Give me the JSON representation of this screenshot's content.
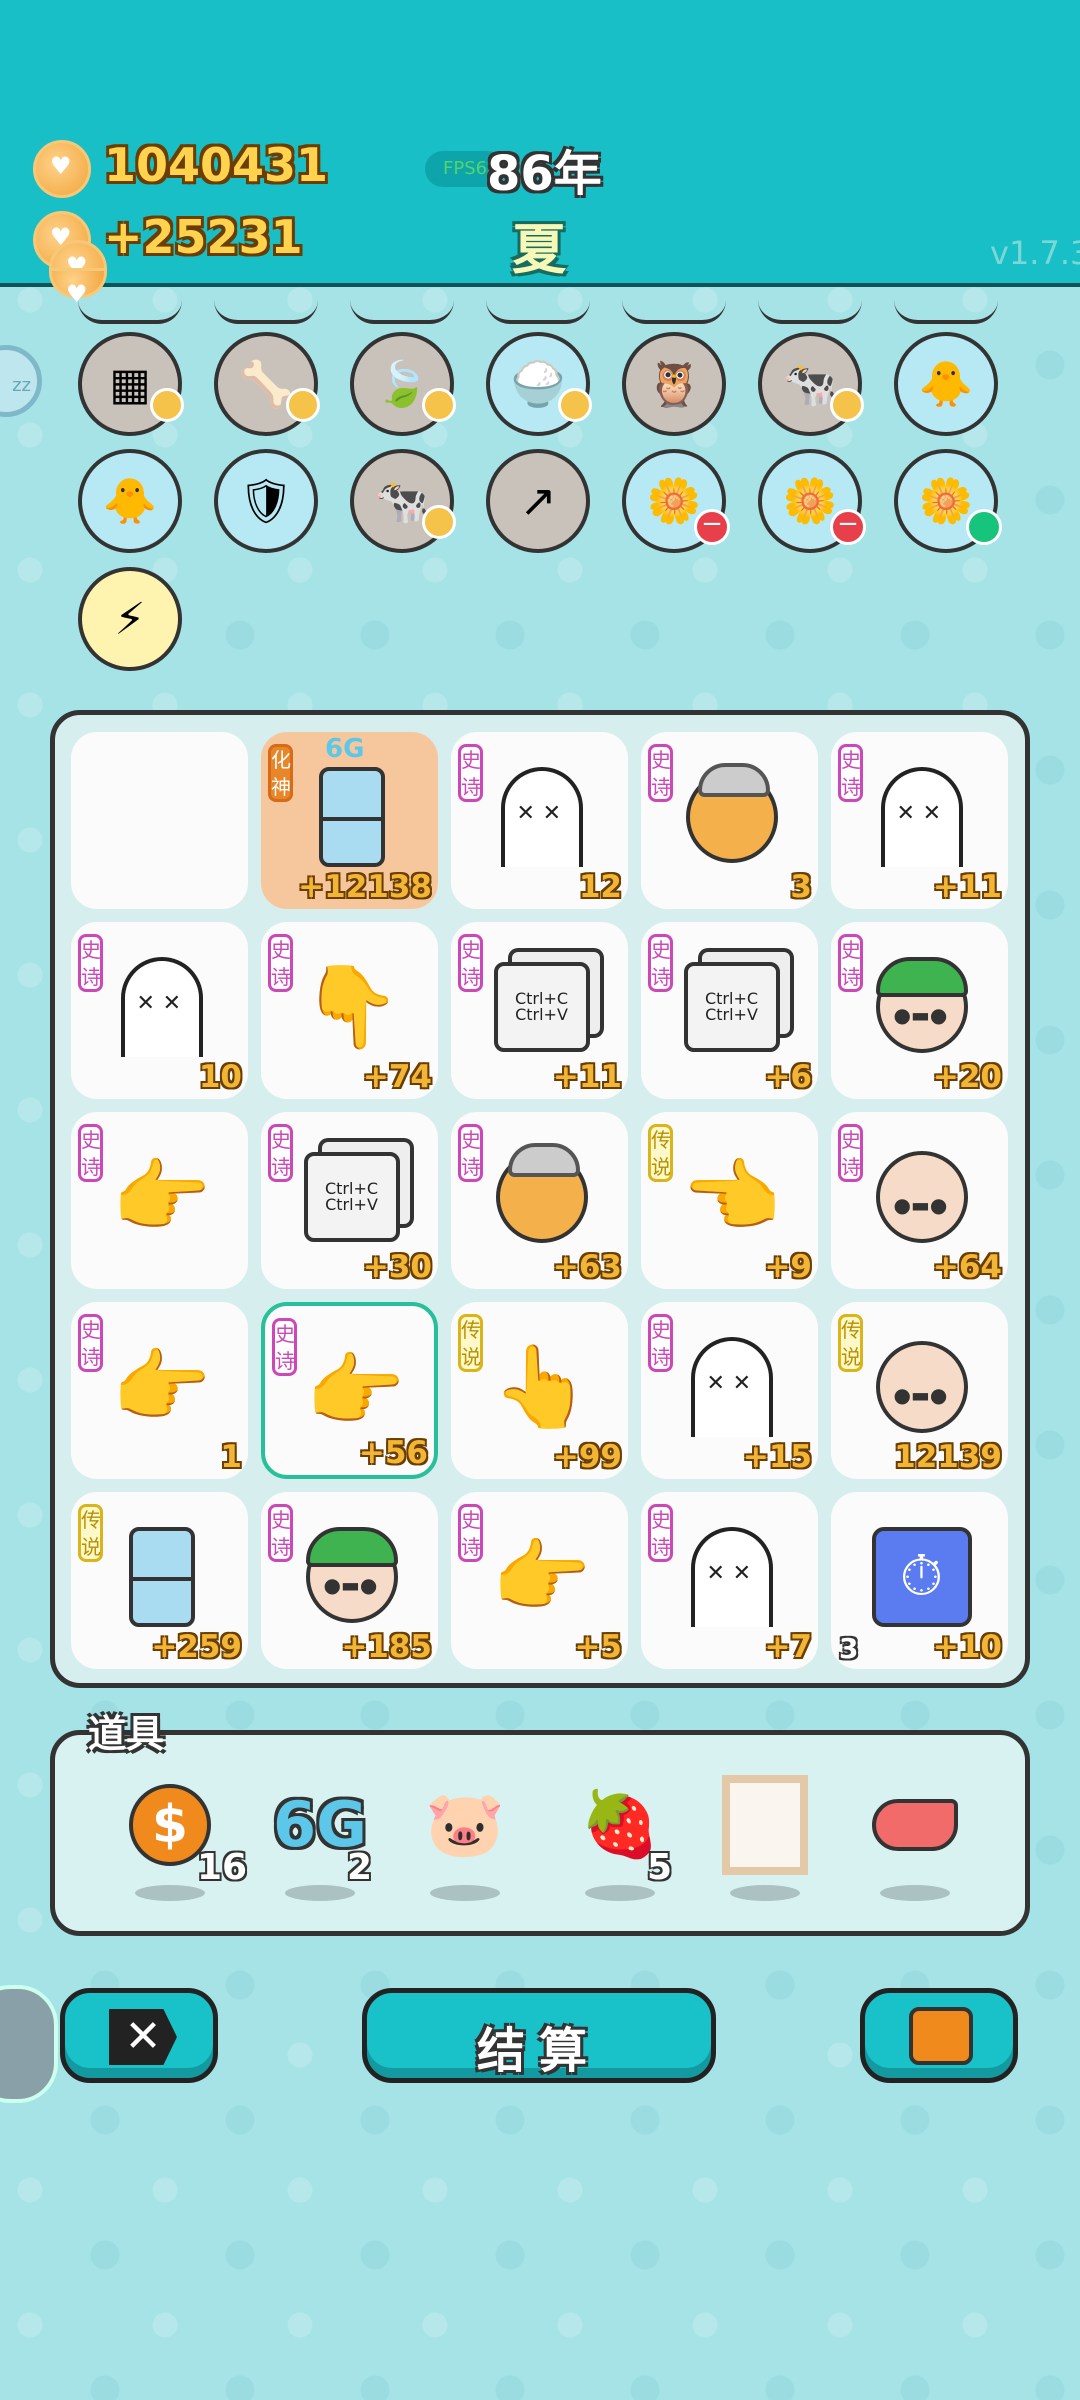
{
  "header": {
    "coins": "1040431",
    "income": "+25231",
    "fps": "FPS60",
    "year": "86年",
    "season": "夏",
    "version": "v1.7.3"
  },
  "side": {
    "zz": "zz"
  },
  "buffs": [
    {
      "name": "sugar-cubes",
      "glyph": "▦"
    },
    {
      "name": "pet-food-bowl",
      "glyph": "🦴"
    },
    {
      "name": "green-leaf",
      "glyph": "🍃"
    },
    {
      "name": "rice-bowl",
      "glyph": "🍚"
    },
    {
      "name": "owl-pair",
      "glyph": "🦉"
    },
    {
      "name": "cow-pair",
      "glyph": "🐄"
    },
    {
      "name": "chick-with-egg",
      "glyph": "🐥"
    },
    {
      "name": "chick-with-egg-2",
      "glyph": "🐥"
    },
    {
      "name": "shield-wrench",
      "glyph": "🛡"
    },
    {
      "name": "cow-pair-2",
      "glyph": "🐄"
    },
    {
      "name": "arrow-up-card",
      "glyph": "↗"
    },
    {
      "name": "flower-pot-minus",
      "glyph": "🌼"
    },
    {
      "name": "flower-pot-minus-2",
      "glyph": "🌼"
    },
    {
      "name": "flower-pot-plus",
      "glyph": "🌼"
    },
    {
      "name": "lightning",
      "glyph": "⚡"
    }
  ],
  "board": [
    [
      {
        "type": "empty",
        "tag": "",
        "num": "",
        "left": ""
      },
      {
        "type": "fridge",
        "tag": "化神",
        "tagStyle": "orng",
        "num": "+12138",
        "left": "",
        "badge": "6G"
      },
      {
        "type": "ghost",
        "tag": "史诗",
        "num": "12",
        "left": ""
      },
      {
        "type": "bird",
        "tag": "史诗",
        "num": "3",
        "left": ""
      },
      {
        "type": "ghost",
        "tag": "史诗",
        "num": "+11",
        "left": ""
      }
    ],
    [
      {
        "type": "ghost",
        "tag": "史诗",
        "num": "10",
        "left": ""
      },
      {
        "type": "hand",
        "glyph": "👇",
        "tag": "史诗",
        "num": "+74",
        "left": ""
      },
      {
        "type": "ctrl",
        "tag": "史诗",
        "num": "+11",
        "left": ""
      },
      {
        "type": "ctrl",
        "tag": "史诗",
        "num": "+6",
        "left": ""
      },
      {
        "type": "hatface",
        "tag": "史诗",
        "num": "+20",
        "left": ""
      }
    ],
    [
      {
        "type": "hand",
        "glyph": "👉",
        "tag": "史诗",
        "num": "",
        "left": ""
      },
      {
        "type": "ctrl",
        "tag": "史诗",
        "num": "+30",
        "left": ""
      },
      {
        "type": "bird",
        "tag": "史诗",
        "num": "+63",
        "left": ""
      },
      {
        "type": "hand",
        "glyph": "👈",
        "tag": "传说",
        "tagStyle": "gold",
        "num": "+9",
        "left": ""
      },
      {
        "type": "face",
        "tag": "史诗",
        "num": "+64",
        "left": ""
      }
    ],
    [
      {
        "type": "hand",
        "glyph": "👉",
        "tag": "史诗",
        "num": "1",
        "left": ""
      },
      {
        "type": "hand",
        "glyph": "👉",
        "tag": "史诗",
        "num": "+56",
        "left": "",
        "selected": true
      },
      {
        "type": "hand",
        "glyph": "👆",
        "tag": "传说",
        "tagStyle": "gold",
        "num": "+99",
        "left": ""
      },
      {
        "type": "ghost",
        "tag": "史诗",
        "num": "+15",
        "left": ""
      },
      {
        "type": "face",
        "tag": "传说",
        "tagStyle": "gold",
        "num": "12139",
        "left": ""
      }
    ],
    [
      {
        "type": "fridge",
        "tag": "传说",
        "tagStyle": "gold",
        "num": "+259",
        "left": ""
      },
      {
        "type": "hatface",
        "tag": "史诗",
        "num": "+185",
        "left": ""
      },
      {
        "type": "hand",
        "glyph": "👉",
        "tag": "史诗",
        "num": "+5",
        "left": ""
      },
      {
        "type": "ghost",
        "tag": "史诗",
        "num": "+7",
        "left": ""
      },
      {
        "type": "timer",
        "tag": "",
        "num": "+10",
        "left": "3"
      }
    ]
  ],
  "ctrl_text": {
    "line1": "Ctrl+C",
    "line2": "Ctrl+V"
  },
  "props": {
    "label": "道具",
    "items": [
      {
        "name": "dollar-coin",
        "count": "16"
      },
      {
        "name": "6g-badge",
        "count": "2"
      },
      {
        "name": "piggy-bank",
        "count": ""
      },
      {
        "name": "strawberry",
        "count": "5"
      },
      {
        "name": "frame",
        "count": ""
      },
      {
        "name": "liver",
        "count": ""
      }
    ],
    "sixg": "6G"
  },
  "buttons": {
    "settle": "结算"
  },
  "colors": {
    "teal": "#18bfc6",
    "epic": "#cc48b8",
    "legend": "#d9b41a"
  }
}
